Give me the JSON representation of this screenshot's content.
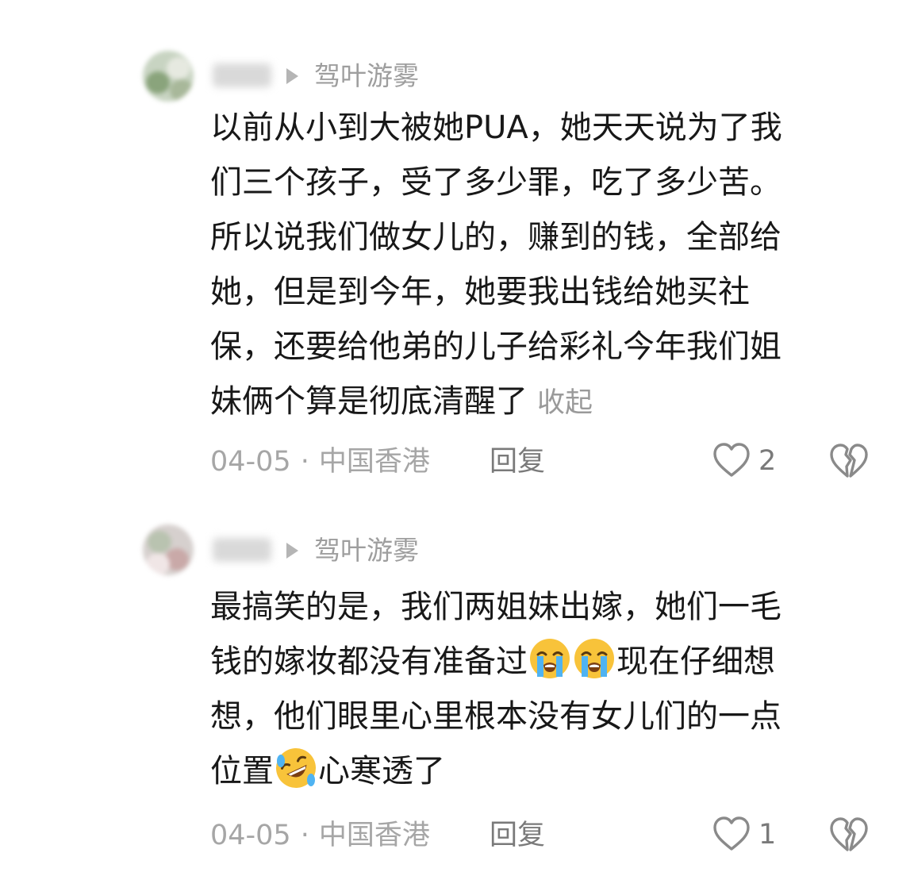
{
  "comments": [
    {
      "reply_to": "驾叶游雾",
      "text_lines": [
        "以前从小到大被她PUA，她天天说为了我",
        "们三个孩子，受了多少罪，吃了多少苦。",
        "所以说我们做女儿的，赚到的钱，全部给",
        "她，但是到今年，她要我出钱给她买社",
        "保，还要给他弟的儿子给彩礼今年我们姐",
        "妹俩个算是彻底清醒了"
      ],
      "collapse_label": "收起",
      "date": "04-05",
      "separator": "·",
      "location": "中国香港",
      "reply_label": "回复",
      "like_count": "2",
      "icons": [
        "heart-outline-icon",
        "broken-heart-icon",
        "play-arrow-icon"
      ]
    },
    {
      "reply_to": "驾叶游雾",
      "text_lines": {
        "line1": "最搞笑的是，我们两姐妹出嫁，她们一毛",
        "line2_a": "钱的嫁妆都没有准备过",
        "line2_b": "现在仔细想",
        "line3": "想，他们眼里心里根本没有女儿们的一点",
        "line4_a": "位置",
        "line4_b": "心寒透了"
      },
      "emojis": [
        "loudly-crying-emoji",
        "loudly-crying-emoji",
        "rolling-laughing-emoji"
      ],
      "date": "04-05",
      "separator": "·",
      "location": "中国香港",
      "reply_label": "回复",
      "like_count": "1",
      "icons": [
        "heart-outline-icon",
        "broken-heart-icon",
        "play-arrow-icon"
      ]
    }
  ],
  "colors": {
    "text": "#181818",
    "meta": "#a6a6a6",
    "reply_button": "#7a7a7a",
    "icon": "#8a8a8a",
    "background": "#ffffff"
  }
}
